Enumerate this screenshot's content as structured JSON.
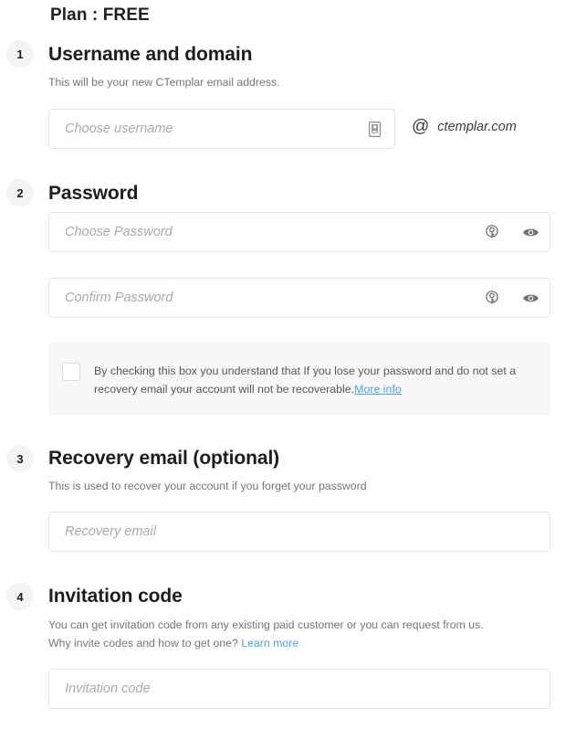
{
  "plan": {
    "label": "Plan : FREE"
  },
  "sections": [
    {
      "number": "1",
      "title": "Username and domain",
      "subtitle": "This will be your new CTemplar email address.",
      "username_placeholder": "Choose username",
      "username_value": "",
      "username_icon": "id-card-icon",
      "at_symbol": "@",
      "domain": "ctemplar.com"
    },
    {
      "number": "2",
      "title": "Password",
      "password_placeholder": "Choose Password",
      "password_value": "",
      "confirm_placeholder": "Confirm Password",
      "confirm_value": "",
      "generate_icon": "key-circle-icon",
      "reveal_icon": "eye-icon",
      "consent": {
        "text_before": "By checking this box you understand that If you lose your password and do not set a recovery email your account will not be recoverable.",
        "link_label": "More info",
        "checked": false
      }
    },
    {
      "number": "3",
      "title": "Recovery email (optional)",
      "subtitle": "This is used to recover your account if you forget your password",
      "recovery_placeholder": "Recovery email",
      "recovery_value": ""
    },
    {
      "number": "4",
      "title": "Invitation code",
      "subtitle_line1": "You can get invitation code from any existing paid customer or you can request from us.",
      "subtitle_line2_before": "Why invite codes and how to get one? ",
      "subtitle_line2_link": "Learn more",
      "invitation_placeholder": "Invitation code",
      "invitation_value": ""
    }
  ],
  "colors": {
    "link": "#4aa3e8",
    "text_primary": "#1d1d20",
    "text_muted": "#74747c",
    "panel_bg": "#f7f7f8",
    "badge_bg": "#f4f4f6",
    "field_border": "#e4e4e8"
  }
}
